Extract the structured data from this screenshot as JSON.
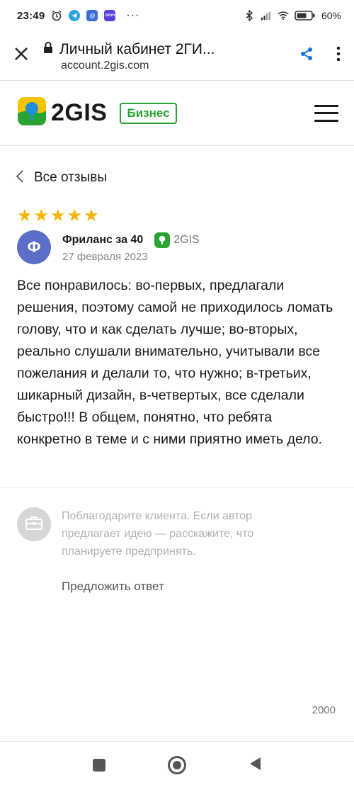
{
  "status_bar": {
    "time": "23:49",
    "battery": "60%",
    "more": "···",
    "app_icons": [
      "alarm-icon",
      "telegram-icon",
      "mail-at-icon",
      "ozon-icon"
    ],
    "ozon_label": "ozon"
  },
  "browser": {
    "title": "Личный кабинет 2ГИ...",
    "url": "account.2gis.com"
  },
  "header": {
    "logo_text": "2GIS",
    "badge": "Бизнес"
  },
  "nav": {
    "back_label": "Все отзывы"
  },
  "review": {
    "rating": 5,
    "avatar_letter": "Ф",
    "author": "Фриланс за 40",
    "source": "2GIS",
    "date": "27 февраля 2023",
    "text": "Все понравилось: во-первых, предлагали решения, поэтому самой не приходилось ломать голову, что и как сделать лучше; во-вторых, реально слушали внимательно, учитывали все пожелания и делали то, что нужно; в-третьих, шикарный дизайн, в-четвертых, все сделали быстро!!! В общем, понятно, что ребята конкретно в теме и с ними приятно иметь дело."
  },
  "reply": {
    "hint": "Поблагодарите клиента. Если автор предлагает идею — расскажите, что планируете предпринять.",
    "suggest_label": "Предложить ответ",
    "char_limit": "2000"
  },
  "colors": {
    "brand_green": "#29a331",
    "star": "#f5b400",
    "avatar": "#5b6fc8",
    "share_blue": "#1a73e8"
  }
}
